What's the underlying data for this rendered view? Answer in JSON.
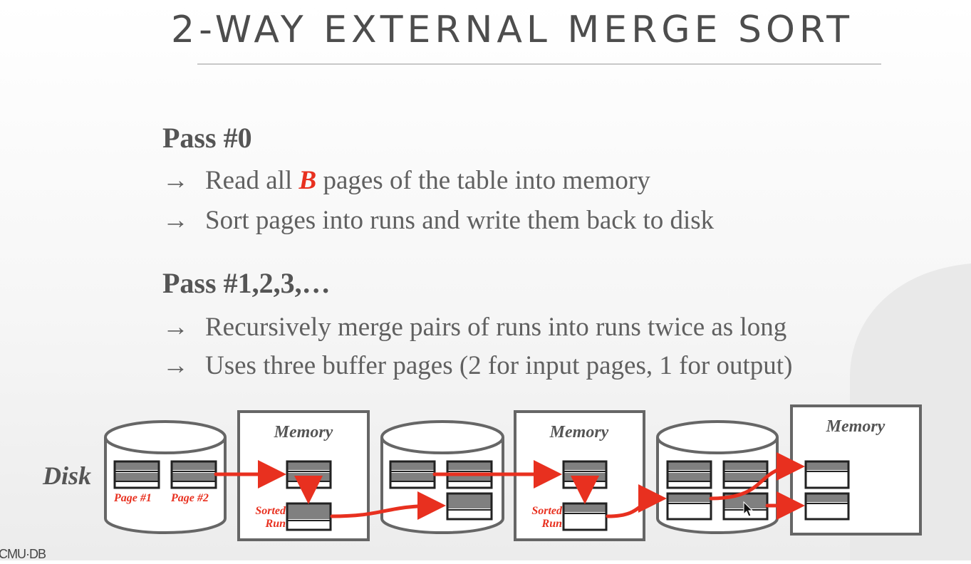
{
  "slide": {
    "title": "2-WAY EXTERNAL MERGE SORT",
    "pass0": {
      "heading": "Pass #0",
      "bullets": [
        {
          "arrow": "→",
          "pre": "Read all ",
          "emphasis": "B",
          "post": " pages of the table into memory"
        },
        {
          "arrow": "→",
          "text": "Sort pages into runs and write them back to disk"
        }
      ]
    },
    "pass1": {
      "heading": "Pass #1,2,3,…",
      "bullets": [
        {
          "arrow": "→",
          "text": "Recursively merge pairs of runs into runs twice as long"
        },
        {
          "arrow": "→",
          "text": "Uses three buffer pages (2 for input pages, 1 for output)"
        }
      ]
    },
    "footer": "CMU·DB"
  },
  "diagram": {
    "disk_label": "Disk",
    "memory_label": "Memory",
    "page1_label": "Page #1",
    "page2_label": "Page #2",
    "sorted_label": "Sorted",
    "run_label": "Run",
    "colors": {
      "accent": "#e8301f",
      "page_fill": "#808080",
      "outline": "#222222",
      "box": "#666666"
    }
  }
}
